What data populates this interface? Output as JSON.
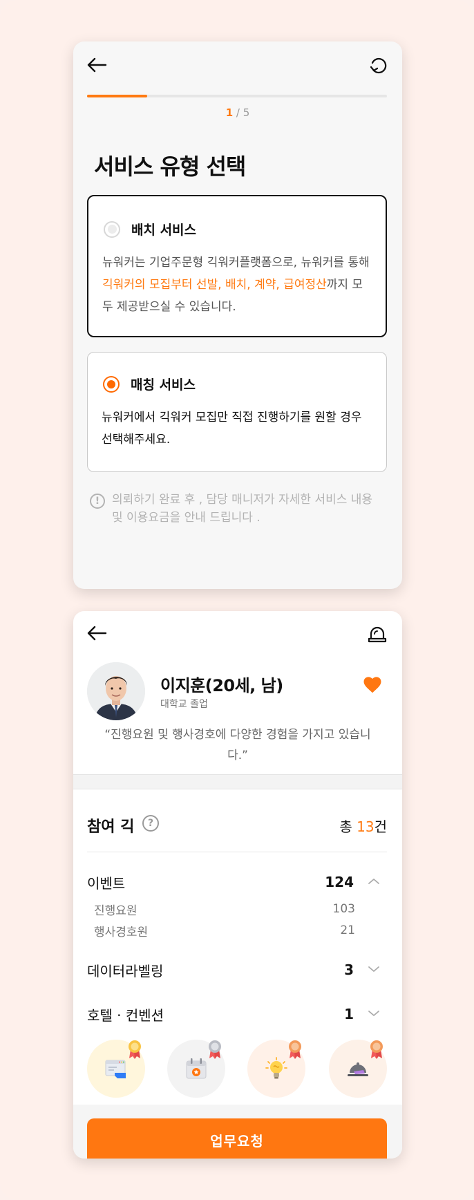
{
  "screen1": {
    "progress": {
      "current": "1",
      "separator": " / ",
      "total": "5",
      "fraction": 0.2
    },
    "title": "서비스 유형 선택",
    "options": [
      {
        "label": "배치 서비스",
        "selected": false,
        "desc_before": "뉴워커는 기업주문형 긱워커플랫폼으로, 뉴워커를 통해 ",
        "desc_highlight": "긱워커의 모집부터 선발, 배치, 계약, 급여정산",
        "desc_after": "까지 모두 제공받으실 수 있습니다."
      },
      {
        "label": "매칭 서비스",
        "selected": true,
        "desc": "뉴워커에서 긱워커 모집만 직접 진행하기를 원할 경우 선택해주세요."
      }
    ],
    "notice": "의뢰하기  완료 후 , 담당 매니저가 자세한 서비스 내용 및 이용요금을 안내 드립니다 .",
    "notice_icon": "!"
  },
  "screen2": {
    "profile": {
      "name": "이지훈(20세, 남)",
      "education": "대학교 졸업",
      "quote": "“진행요원 및 행사경호에 다양한 경험을 가지고 있습니다.”",
      "favorite": true
    },
    "gigs": {
      "title": "참여 긱",
      "help_icon": "?",
      "total_prefix": "총 ",
      "total_count": "13",
      "total_suffix": "건",
      "categories": [
        {
          "name": "이벤트",
          "count": "124",
          "expanded": true,
          "subs": [
            {
              "name": "진행요원",
              "count": "103"
            },
            {
              "name": "행사경호원",
              "count": "21"
            }
          ]
        },
        {
          "name": "데이터라벨링",
          "count": "3",
          "expanded": false
        },
        {
          "name": "호텔 · 컨벤션",
          "count": "1",
          "expanded": false
        }
      ]
    },
    "badges": [
      {
        "icon": "computer-icon",
        "medal": "gold"
      },
      {
        "icon": "calendar-star-icon",
        "medal": "silver"
      },
      {
        "icon": "lightbulb-icon",
        "medal": "bronze"
      },
      {
        "icon": "cloche-icon",
        "medal": "bronze"
      }
    ],
    "cta_label": "업무요청"
  },
  "colors": {
    "accent": "#ff7a11",
    "background": "#fef0eb"
  }
}
